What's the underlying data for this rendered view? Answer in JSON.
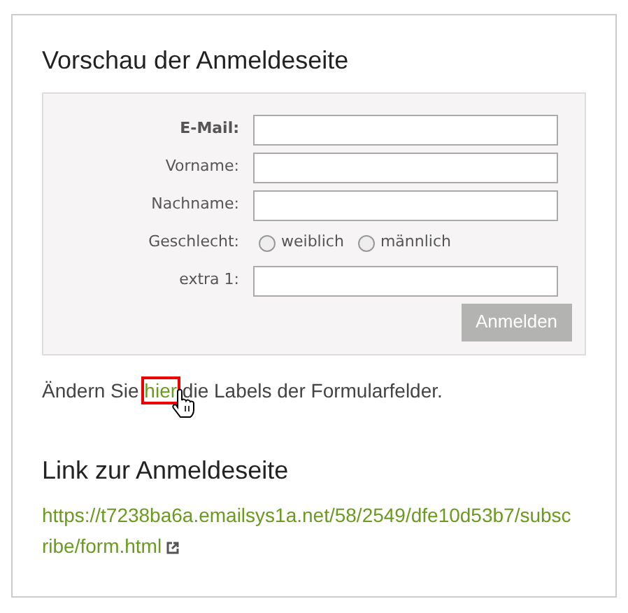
{
  "preview": {
    "title": "Vorschau der Anmeldeseite",
    "fields": [
      {
        "kind": "text",
        "label": "E-Mail:",
        "bold": true
      },
      {
        "kind": "text",
        "label": "Vorname:",
        "bold": false
      },
      {
        "kind": "text",
        "label": "Nachname:",
        "bold": false
      },
      {
        "kind": "radio",
        "label": "Geschlecht:",
        "bold": false,
        "options": [
          {
            "label": "weiblich",
            "selected": false
          },
          {
            "label": "männlich",
            "selected": false
          }
        ]
      },
      {
        "kind": "text",
        "label": "extra 1:",
        "bold": false
      }
    ],
    "submit_button": {
      "label": "Anmelden",
      "disabled": true
    }
  },
  "hint": {
    "before": "Ändern Sie",
    "link": "hier",
    "link_highlighted": true,
    "after": "die Labels der Formularfelder."
  },
  "link_section": {
    "title": "Link zur Anmeldeseite",
    "url_lines": [
      "https://t7238ba6a.emailsys1a.net/58/2549/dfe10d53b7/subsc",
      "ribe/form.html"
    ]
  }
}
